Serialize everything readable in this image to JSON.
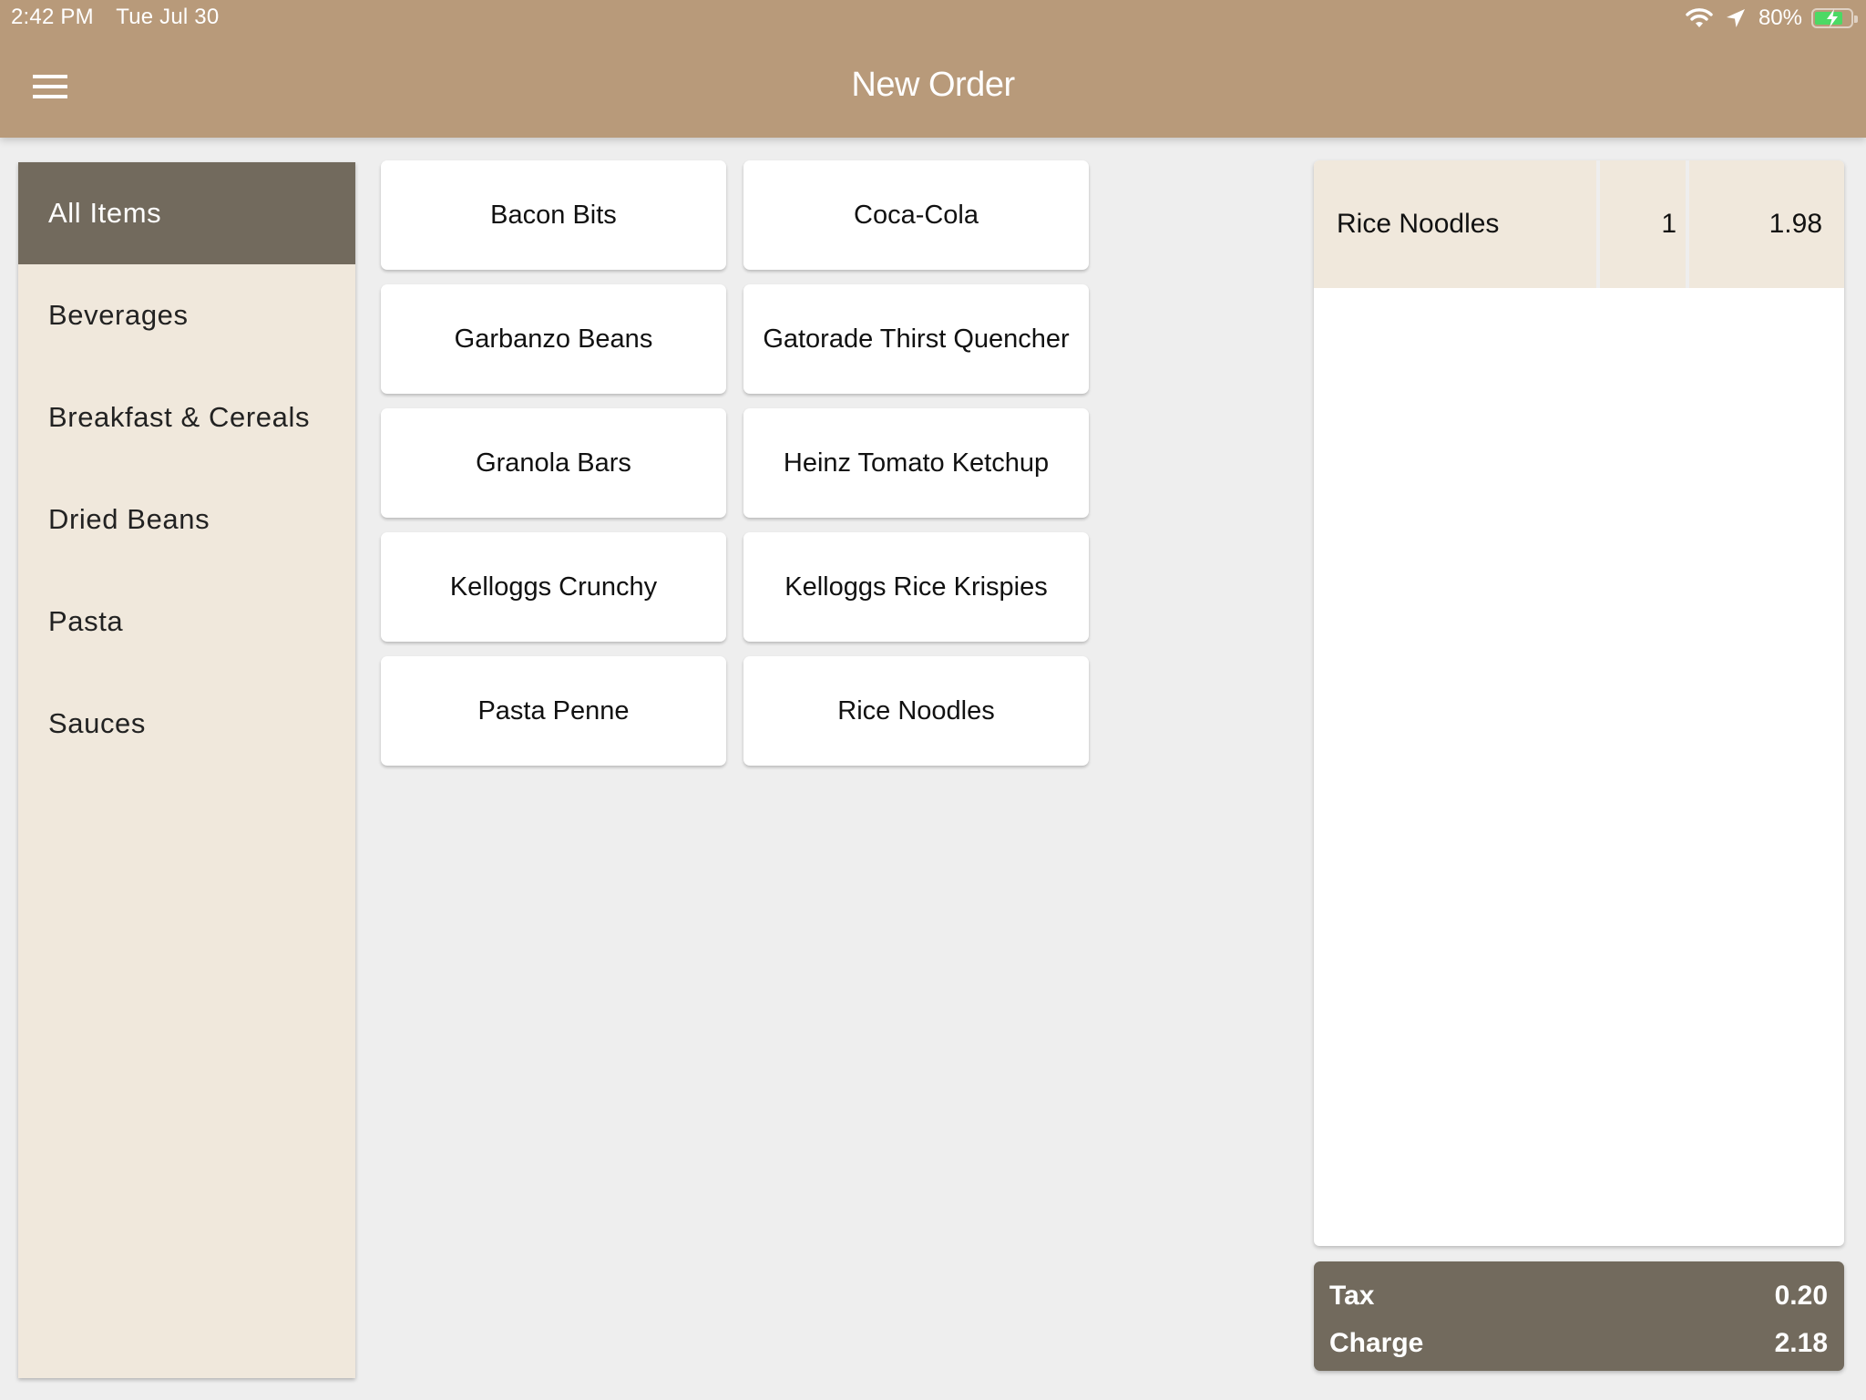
{
  "status_bar": {
    "time": "2:42 PM",
    "date": "Tue Jul 30",
    "battery_percent": "80%",
    "battery_level": 0.8,
    "icons": [
      "wifi-icon",
      "location-arrow-icon",
      "battery-charging-icon"
    ]
  },
  "header": {
    "title": "New Order",
    "menu_icon": "hamburger-menu-icon",
    "color": "#b89a7a"
  },
  "sidebar": {
    "items": [
      {
        "label": "All Items",
        "active": true
      },
      {
        "label": "Beverages",
        "active": false
      },
      {
        "label": "Breakfast & Cereals",
        "active": false
      },
      {
        "label": "Dried Beans",
        "active": false
      },
      {
        "label": "Pasta",
        "active": false
      },
      {
        "label": "Sauces",
        "active": false
      }
    ],
    "active_color": "#726a5d",
    "background_color": "#f0e8dc"
  },
  "products": [
    {
      "label": "Bacon Bits"
    },
    {
      "label": "Coca-Cola"
    },
    {
      "label": "Garbanzo Beans"
    },
    {
      "label": "Gatorade Thirst Quencher"
    },
    {
      "label": "Granola Bars"
    },
    {
      "label": "Heinz Tomato Ketchup"
    },
    {
      "label": "Kelloggs Crunchy"
    },
    {
      "label": "Kelloggs Rice Krispies"
    },
    {
      "label": "Pasta Penne"
    },
    {
      "label": "Rice Noodles"
    }
  ],
  "order": {
    "lines": [
      {
        "name": "Rice Noodles",
        "qty": "1",
        "price": "1.98"
      }
    ]
  },
  "totals": {
    "tax_label": "Tax",
    "tax_value": "0.20",
    "charge_label": "Charge",
    "charge_value": "2.18"
  }
}
